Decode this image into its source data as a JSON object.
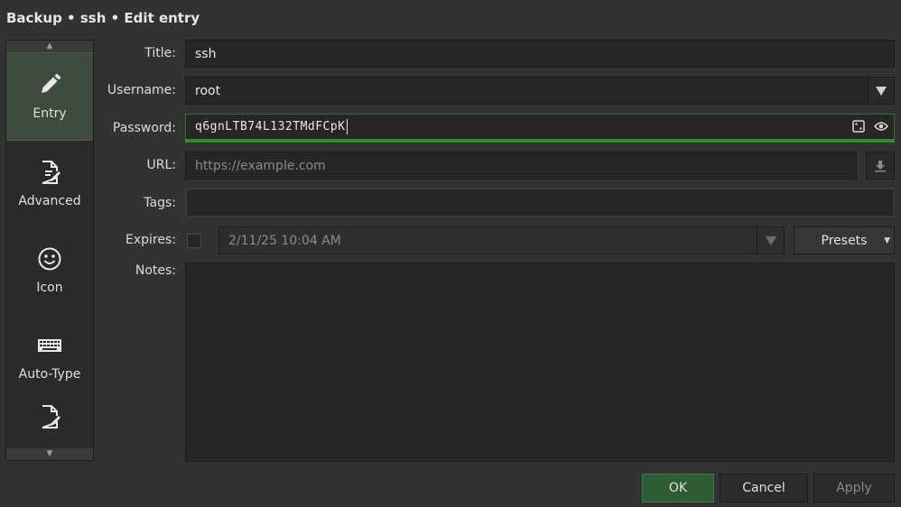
{
  "window": {
    "title": "Backup • ssh • Edit entry"
  },
  "sidebar": {
    "items": [
      {
        "label": "Entry",
        "icon": "pencil-icon",
        "active": true
      },
      {
        "label": "Advanced",
        "icon": "document-edit-icon"
      },
      {
        "label": "Icon",
        "icon": "smiley-icon"
      },
      {
        "label": "Auto-Type",
        "icon": "keyboard-icon"
      },
      {
        "label": "",
        "icon": "document-edit-icon"
      }
    ]
  },
  "form": {
    "title_label": "Title:",
    "title_value": "ssh",
    "username_label": "Username:",
    "username_value": "root",
    "password_label": "Password:",
    "password_value": "q6gnLTB74L132TMdFCpK",
    "url_label": "URL:",
    "url_placeholder": "https://example.com",
    "tags_label": "Tags:",
    "expires_label": "Expires:",
    "expires_value": "2/11/25 10:04 AM",
    "presets_label": "Presets",
    "notes_label": "Notes:"
  },
  "buttons": {
    "ok": "OK",
    "cancel": "Cancel",
    "apply": "Apply"
  },
  "colors": {
    "accent": "#2f5c34",
    "strength": "#2e8b2e"
  }
}
